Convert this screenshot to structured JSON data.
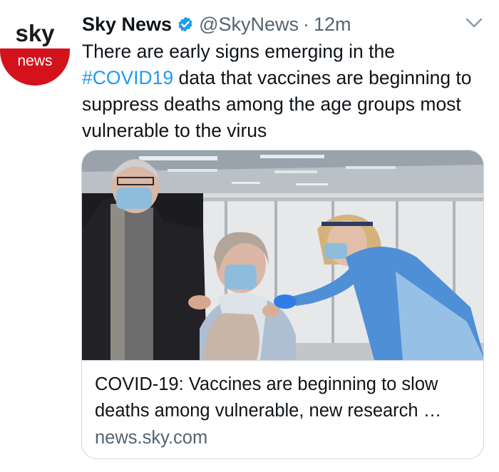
{
  "tweet": {
    "avatar": {
      "logo_top": "sky",
      "logo_bottom": "news"
    },
    "display_name": "Sky News",
    "handle": "@SkyNews",
    "separator": "·",
    "time": "12m",
    "text_before": "There are early signs emerging in the ",
    "hashtag": "#COVID19",
    "text_after": " data that vaccines are beginning to suppress deaths among the age groups most vulnerable to the virus",
    "card": {
      "title": "COVID-19: Vaccines are beginning to slow deaths among vulnerable, new research …",
      "domain": "news.sky.com"
    }
  },
  "colors": {
    "link": "#1d9bf0",
    "secondary_text": "#536471",
    "sky_red": "#d3121b",
    "verified": "#1d9bf0",
    "nurse_apron": "#4f8fd6"
  },
  "icons": {
    "verified": "verified-badge-icon",
    "caret": "chevron-down-icon"
  }
}
